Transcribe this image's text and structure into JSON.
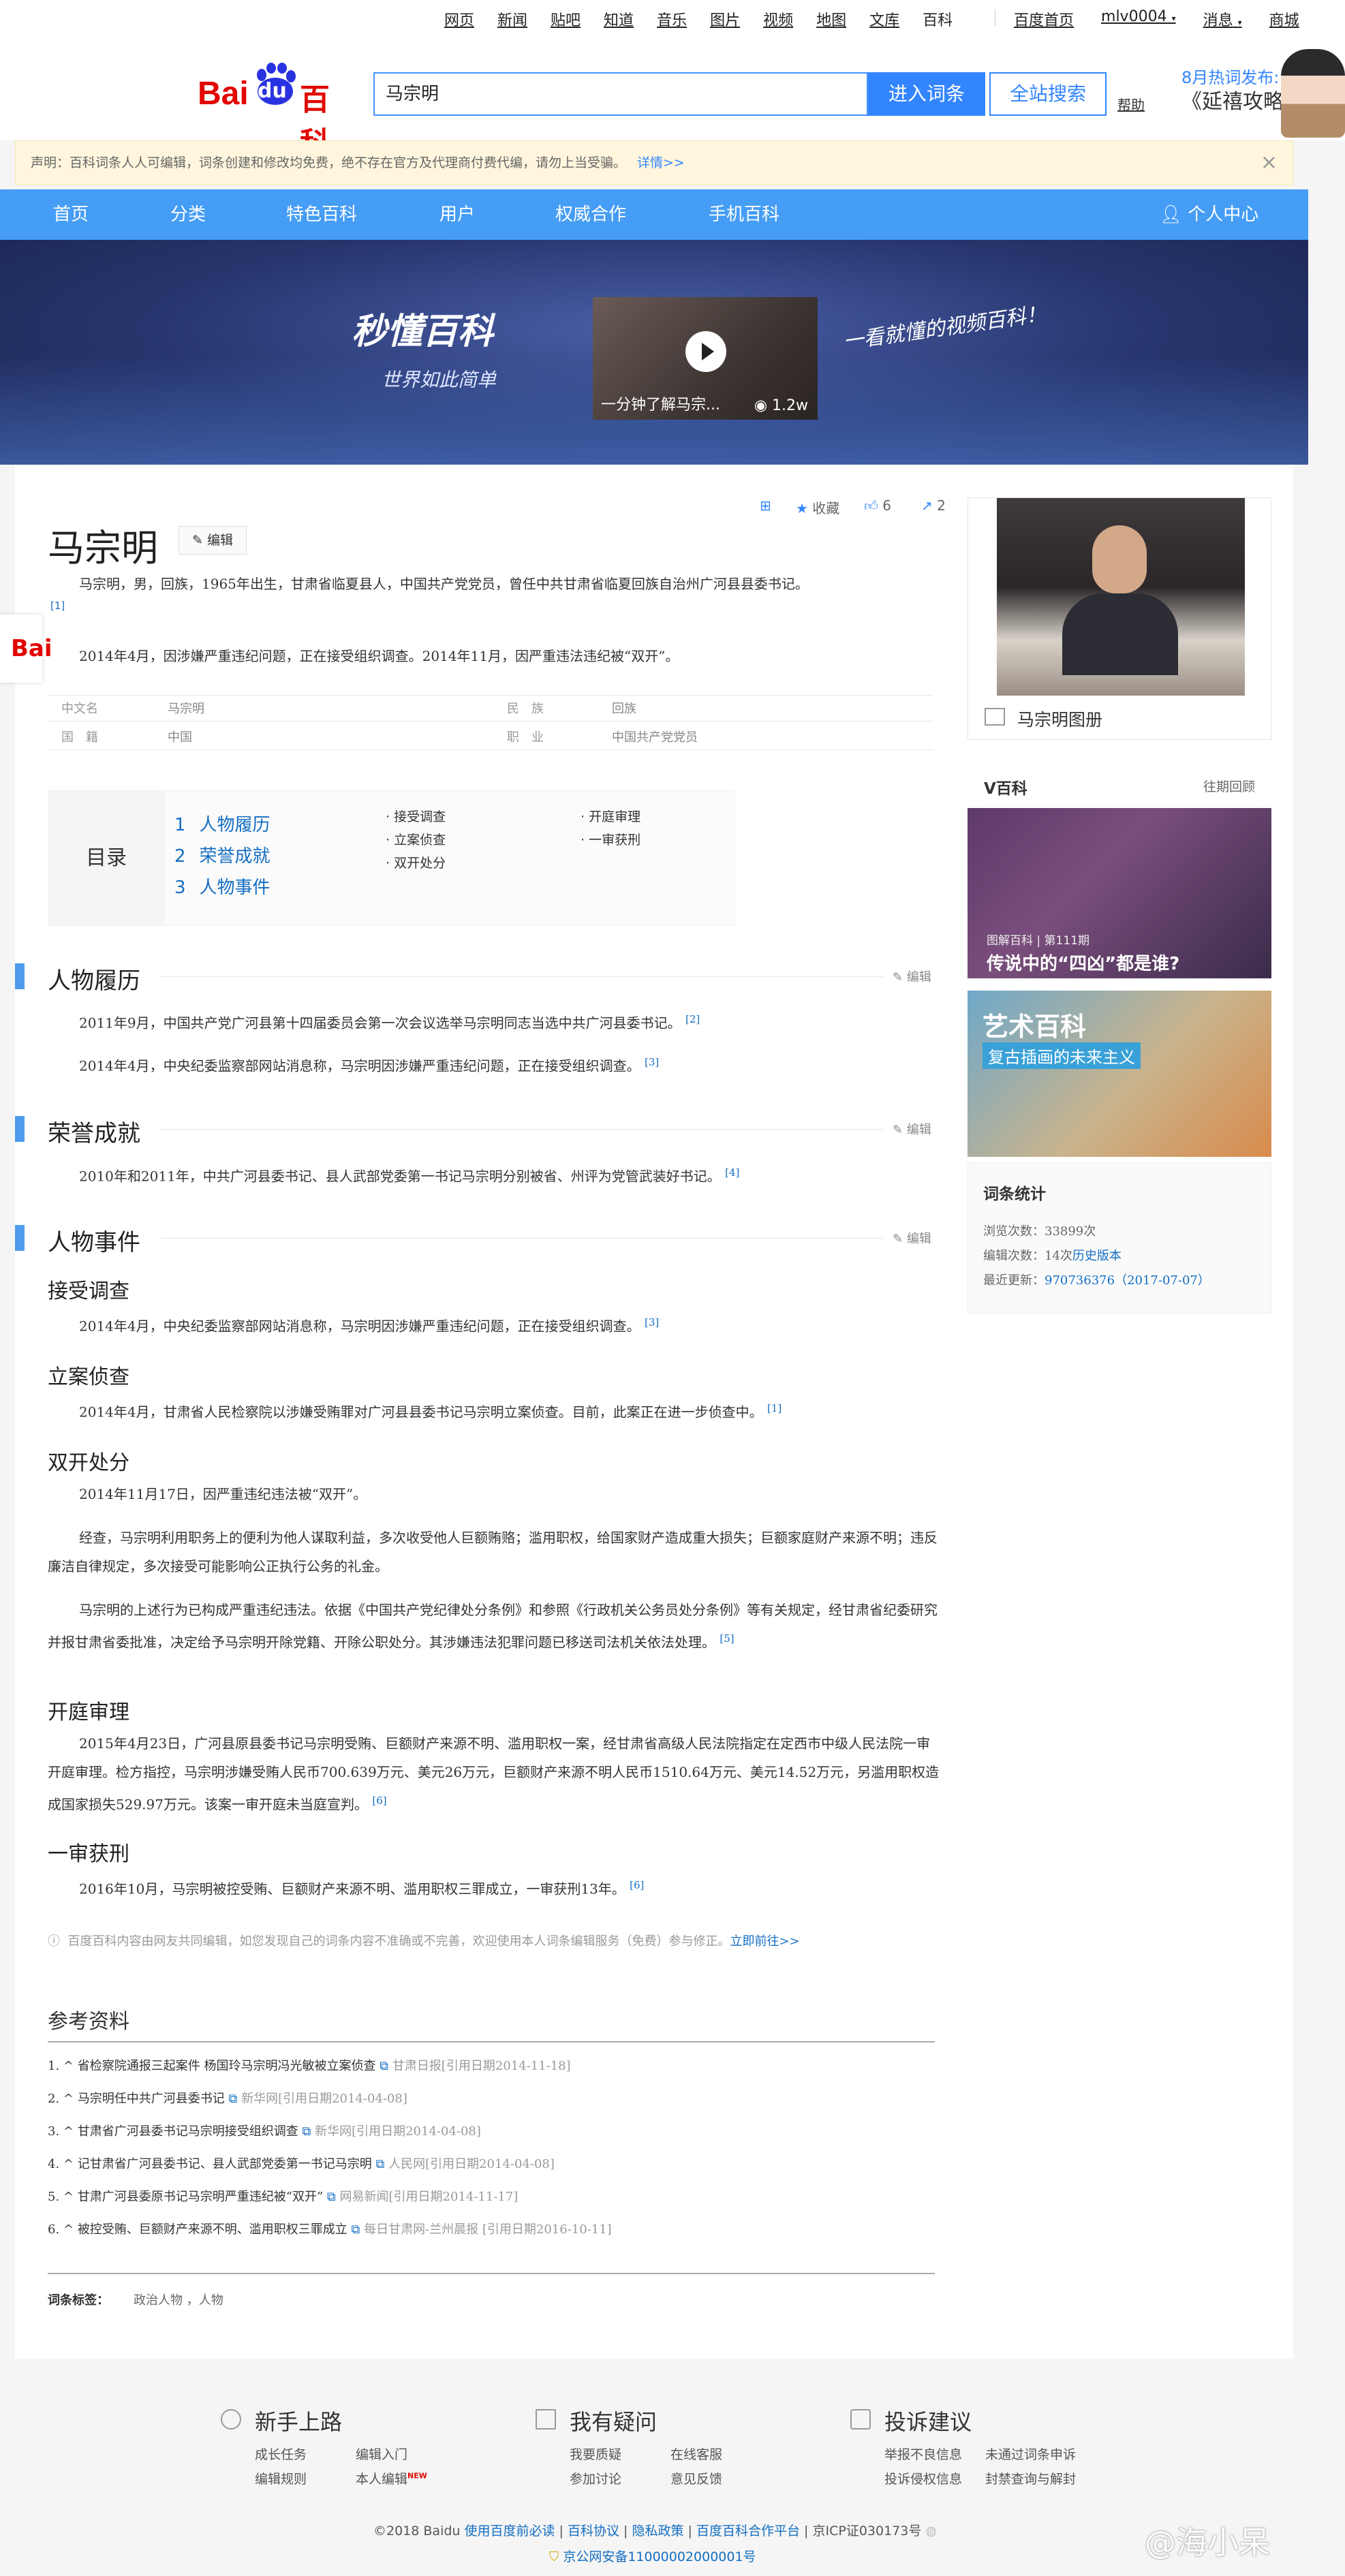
{
  "top_links": [
    "网页",
    "新闻",
    "贴吧",
    "知道",
    "音乐",
    "图片",
    "视频",
    "地图",
    "文库",
    "百科"
  ],
  "top_right": {
    "home": "百度首页",
    "user": "mlv0004",
    "msg": "消息",
    "mall": "商城"
  },
  "logo": {
    "bai": "Bai",
    "du": "du",
    "baike": "百科"
  },
  "search": {
    "value": "马宗明",
    "enter_label": "进入词条",
    "all_label": "全站搜索",
    "help": "帮助"
  },
  "hot": {
    "label": "8月热词发布:",
    "title": "《延禧攻略》"
  },
  "notice": {
    "text": "声明：百科词条人人可编辑，词条创建和修改均免费，绝不存在官方及代理商付费代编，请勿上当受骗。",
    "more": "详情>>",
    "close": "×"
  },
  "nav": [
    "首页",
    "分类",
    "特色百科",
    "用户",
    "权威合作",
    "手机百科"
  ],
  "nav_personal": "个人中心",
  "banner": {
    "brand": "秒懂百科",
    "slogan": "世界如此简单",
    "video_caption": "一分钟了解马宗...",
    "video_views": "1.2w",
    "hand": "一看就懂的视频百科！"
  },
  "title": "马宗明",
  "edit_label": "编辑",
  "tools": {
    "collect": "收藏",
    "like": "6",
    "share": "2"
  },
  "summary1": "马宗明，男，回族，1965年出生，甘肃省临夏县人，中国共产党党员，曾任中共甘肃省临夏回族自治州广河县县委书记。",
  "summary1_ref": "[1]",
  "summary2": "2014年4月，因涉嫌严重违纪问题，正在接受组织调查。2014年11月，因严重违法违纪被“双开”。",
  "basic_info": [
    {
      "label": "中文名",
      "value": "马宗明"
    },
    {
      "label": "民　族",
      "value": "回族"
    },
    {
      "label": "国　籍",
      "value": "中国"
    },
    {
      "label": "职　业",
      "value": "中国共产党党员"
    }
  ],
  "catalog": {
    "head": "目录",
    "main": [
      {
        "num": "1",
        "label": "人物履历"
      },
      {
        "num": "2",
        "label": "荣誉成就"
      },
      {
        "num": "3",
        "label": "人物事件"
      }
    ],
    "sub_a": [
      "接受调查",
      "立案侦查",
      "双开处分"
    ],
    "sub_b": [
      "开庭审理",
      "一审获刑"
    ]
  },
  "sections": {
    "s1": {
      "title": "人物履历",
      "edit": "编辑",
      "p1": "2011年9月，中国共产党广河县第十四届委员会第一次会议选举马宗明同志当选中共广河县委书记。",
      "p1_ref": "[2]",
      "p2": "2014年4月，中央纪委监察部网站消息称，马宗明因涉嫌严重违纪问题，正在接受组织调查。",
      "p2_ref": "[3]"
    },
    "s2": {
      "title": "荣誉成就",
      "edit": "编辑",
      "p1": "2010年和2011年，中共广河县委书记、县人武部党委第一书记马宗明分别被省、州评为党管武装好书记。",
      "p1_ref": "[4]"
    },
    "s3": {
      "title": "人物事件",
      "edit": "编辑",
      "a_title": "接受调查",
      "a_p": "2014年4月，中央纪委监察部网站消息称，马宗明因涉嫌严重违纪问题，正在接受组织调查。",
      "a_ref": "[3]",
      "b_title": "立案侦查",
      "b_p": "2014年4月，甘肃省人民检察院以涉嫌受贿罪对广河县县委书记马宗明立案侦查。目前，此案正在进一步侦查中。",
      "b_ref": "[1]",
      "c_title": "双开处分",
      "c_p1": "2014年11月17日，因严重违纪违法被“双开”。",
      "c_p2": "经查，马宗明利用职务上的便利为他人谋取利益，多次收受他人巨额贿赂；滥用职权，给国家财产造成重大损失；巨额家庭财产来源不明；违反廉洁自律规定，多次接受可能影响公正执行公务的礼金。",
      "c_p3": "马宗明的上述行为已构成严重违纪违法。依据《中国共产党纪律处分条例》和参照《行政机关公务员处分条例》等有关规定，经甘肃省纪委研究并报甘肃省委批准，决定给予马宗明开除党籍、开除公职处分。其涉嫌违法犯罪问题已移送司法机关依法处理。",
      "c_ref": "[5]",
      "d_title": "开庭审理",
      "d_p": "2015年4月23日，广河县原县委书记马宗明受贿、巨额财产来源不明、滥用职权一案，经甘肃省高级人民法院指定在定西市中级人民法院一审开庭审理。检方指控，马宗明涉嫌受贿人民币700.639万元、美元26万元，巨额财产来源不明人民币1510.64万元、美元14.52万元，另滥用职权造成国家损失529.97万元。该案一审开庭未当庭宣判。",
      "d_ref": "[6]",
      "e_title": "一审获刑",
      "e_p": "2016年10月，马宗明被控受贿、巨额财产来源不明、滥用职权三罪成立，一审获刑13年。",
      "e_ref": "[6]"
    }
  },
  "bottom_note": {
    "text": "百度百科内容由网友共同编辑，如您发现自己的词条内容不准确或不完善，欢迎使用本人词条编辑服务（免费）参与修正。",
    "link": "立即前往>>"
  },
  "references": {
    "title": "参考资料",
    "items": [
      {
        "n": "1.",
        "title": "省检察院通报三起案件 杨国玲马宗明冯光敏被立案侦查",
        "src": "甘肃日报[引用日期2014-11-18]"
      },
      {
        "n": "2.",
        "title": "马宗明任中共广河县委书记",
        "src": "新华网[引用日期2014-04-08]"
      },
      {
        "n": "3.",
        "title": "甘肃省广河县委书记马宗明接受组织调查",
        "src": "新华网[引用日期2014-04-08]"
      },
      {
        "n": "4.",
        "title": "记甘肃省广河县委书记、县人武部党委第一书记马宗明",
        "src": "人民网[引用日期2014-04-08]"
      },
      {
        "n": "5.",
        "title": "甘肃广河县委原书记马宗明严重违纪被“双开”",
        "src": "网易新闻[引用日期2014-11-17]"
      },
      {
        "n": "6.",
        "title": "被控受贿、巨额财产来源不明、滥用职权三罪成立",
        "src": "每日甘肃网-兰州晨报 [引用日期2016-10-11]"
      }
    ]
  },
  "tags": {
    "label": "词条标签：",
    "value": "政治人物 ，人物"
  },
  "album": {
    "caption": "马宗明图册"
  },
  "vbaike": {
    "title": "V百科",
    "more": "往期回顾",
    "card1_ep": "图解百科 | 第111期",
    "card1_title": "传说中的“四凶”都是谁?",
    "card2_title": "艺术百科",
    "card2_sub": "复古插画的未来主义"
  },
  "stats": {
    "title": "词条统计",
    "views_label": "浏览次数：",
    "views": "33899",
    "views_unit": "次",
    "edits_label": "编辑次数：",
    "edits": "14次",
    "edits_link": "历史版本",
    "updated_label": "最近更新：",
    "updated": "970736376（2017-07-07）"
  },
  "footer": {
    "col1": {
      "title": "新手上路",
      "links": [
        "成长任务",
        "编辑入门",
        "编辑规则",
        "本人编辑"
      ]
    },
    "col2": {
      "title": "我有疑问",
      "links": [
        "我要质疑",
        "在线客服",
        "参加讨论",
        "意见反馈"
      ]
    },
    "col3": {
      "title": "投诉建议",
      "links": [
        "举报不良信息",
        "未通过词条申诉",
        "投诉侵权信息",
        "封禁查询与解封"
      ]
    },
    "new_badge": "NEW",
    "copyright_pre": "©2018 Baidu",
    "copyright_links": [
      "使用百度前必读",
      "百科协议",
      "隐私政策",
      "百度百科合作平台"
    ],
    "icp": "京ICP证030173号",
    "beian": "京公网安备11000002000001号",
    "watermark": "@海小呆"
  }
}
